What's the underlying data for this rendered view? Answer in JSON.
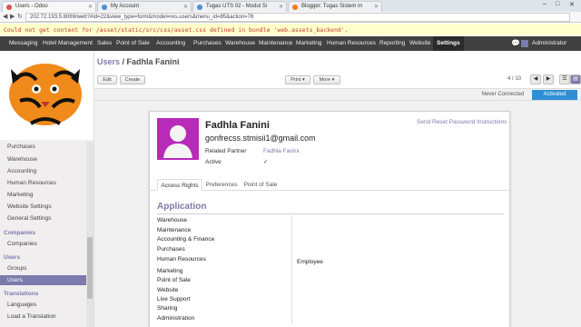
{
  "browser": {
    "tabs": [
      {
        "title": "Users - Odoo",
        "favicon_color": "#d9534f"
      },
      {
        "title": "My Account",
        "favicon_color": "#4a90d9"
      },
      {
        "title": "Tugas UTS 02 - Modul Si",
        "favicon_color": "#4a90d9"
      },
      {
        "title": "Blogger: Tugas Sistem In",
        "favicon_color": "#f57d00"
      }
    ],
    "window_controls": {
      "minimize": "–",
      "maximize": "□",
      "close": "✕"
    },
    "nav": {
      "back": "◀",
      "forward": "▶",
      "reload": "↻"
    },
    "url": "202.72.193.5:8069/web?#id=22&view_type=form&model=res.users&menu_id=85&action=76"
  },
  "warning": "Could not get content for /asset/static/src/css/asset.css defined in bundle 'web.assets_backend'.",
  "menubar": {
    "items": [
      "Messaging",
      "Hotel Management",
      "Sales",
      "Point of Sale",
      "Accounting",
      "Purchases",
      "Warehouse",
      "Maintenance",
      "Marketing",
      "Human Resources",
      "Reporting",
      "Website",
      "Settings"
    ],
    "active": "Settings",
    "user": "Administrator",
    "chat_icon": "chat-icon"
  },
  "sidebar": {
    "items_top": [
      "Purchases",
      "Warehouse",
      "Accounting",
      "Human Resources",
      "Marketing",
      "Website Settings",
      "General Settings"
    ],
    "companies_header": "Companies",
    "companies_items": [
      "Companies"
    ],
    "users_header": "Users",
    "users_items": [
      "Groups",
      "Users"
    ],
    "active_item": "Users",
    "translations_header": "Translations",
    "translations_items": [
      "Languages",
      "Load a Translation"
    ]
  },
  "header": {
    "breadcrumb_link": "Users",
    "breadcrumb_sep": " / ",
    "breadcrumb_current": "Fadhla Fanini",
    "edit_label": "Edit",
    "create_label": "Create",
    "print_label": "Print ▾",
    "more_label": "More ▾",
    "pager": "4 / 10",
    "prev": "◀",
    "next": "▶"
  },
  "status": {
    "steps": [
      "Never Connected",
      "Activated"
    ],
    "active": "Activated"
  },
  "form": {
    "name": "Fadhla Fanini",
    "email": "gonfrecss.stmisii1@gmail.com",
    "reset_link": "Send Reset Password Instructions",
    "related_partner_label": "Related Partner",
    "related_partner_value": "Fadhla Fanini",
    "active_label": "Active",
    "active_checked": "✓"
  },
  "tabs": {
    "items": [
      "Access Rights",
      "Preferences",
      "Point of Sale"
    ],
    "active": "Access Rights"
  },
  "application": {
    "title": "Application",
    "rows": [
      {
        "label": "Warehouse",
        "value": ""
      },
      {
        "label": "Maintenance",
        "value": ""
      },
      {
        "label": "Accounting & Finance",
        "value": ""
      },
      {
        "label": "Purchases",
        "value": ""
      },
      {
        "label": "Human Resources",
        "value": "Employee"
      },
      {
        "label": "Marketing",
        "value": ""
      },
      {
        "label": "Point of Sale",
        "value": ""
      },
      {
        "label": "Website",
        "value": ""
      },
      {
        "label": "Live Support",
        "value": ""
      },
      {
        "label": "Sharing",
        "value": ""
      },
      {
        "label": "Administration",
        "value": ""
      }
    ]
  },
  "colors": {
    "accent": "#7c7bad",
    "menubar": "#414141",
    "status_active": "#2f8fd5"
  }
}
